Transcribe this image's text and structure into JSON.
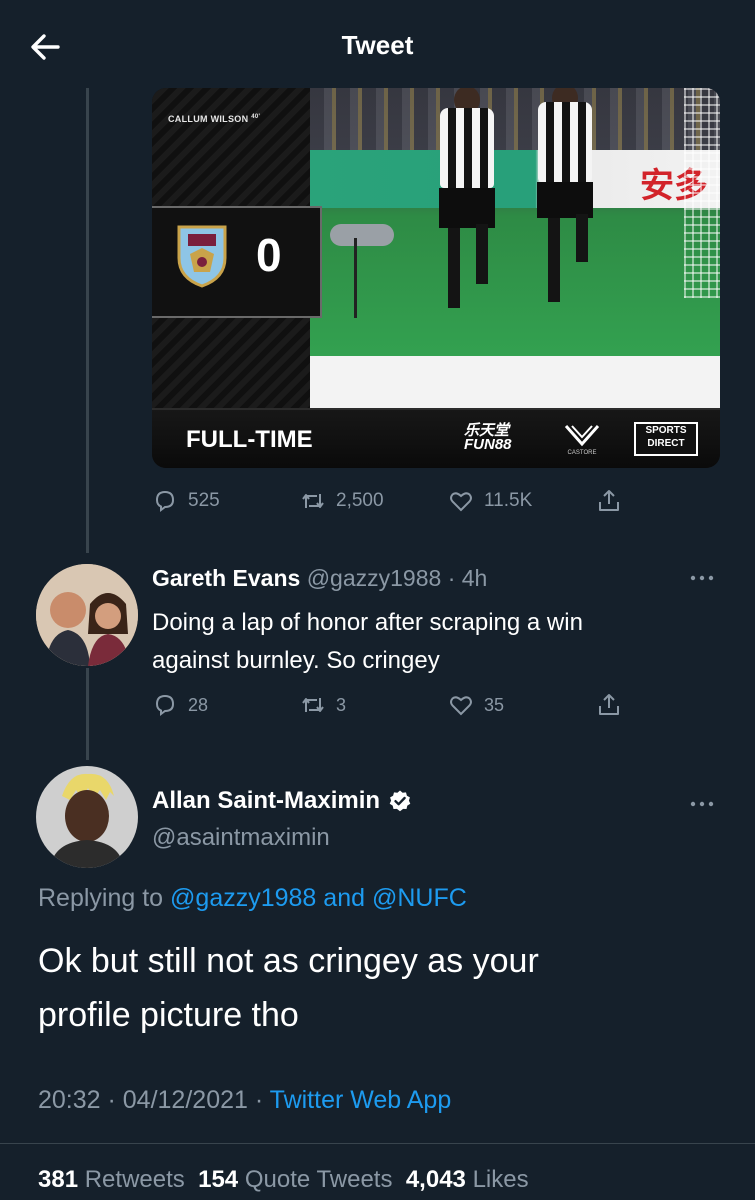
{
  "header": {
    "title": "Tweet"
  },
  "quoted_media": {
    "scorer_text": "CALLUM WILSON",
    "scorer_minute": "40'",
    "score": "0",
    "status": "FULL-TIME",
    "sponsor_1": "乐天堂\nFUN88",
    "sponsor_2": "CASTORE",
    "sponsor_3": "SPORTS\nDIRECT",
    "ad_text": "安多"
  },
  "top_tweet_actions": {
    "replies": "525",
    "retweets": "2,500",
    "likes": "11.5K"
  },
  "reply_tweet": {
    "name": "Gareth Evans",
    "handle": "@gazzy1988",
    "time": "· 4h",
    "text_line1": "Doing a lap of honor after scraping a win",
    "text_line2": "against burnley. So cringey",
    "replies": "28",
    "retweets": "3",
    "likes": "35"
  },
  "main_tweet": {
    "name": "Allan Saint-Maximin",
    "handle": "@asaintmaximin",
    "replying_prefix": "Replying to",
    "replying_to_1": "@gazzy1988",
    "replying_and": "and",
    "replying_to_2": "@NUFC",
    "text_line1": "Ok but still not as cringey as your",
    "text_line2": "profile picture tho",
    "timestamp": "20:32 · 04/12/2021 ·",
    "source": "Twitter Web App"
  },
  "stats": {
    "retweets_count": "381",
    "retweets_label": "Retweets",
    "quotes_count": "154",
    "quotes_label": "Quote Tweets",
    "likes_count": "4,043",
    "likes_label": "Likes"
  },
  "icons": {
    "back": "arrow-left-icon",
    "reply": "reply-icon",
    "retweet": "retweet-icon",
    "like": "heart-icon",
    "share": "share-icon",
    "verified": "verified-badge-icon",
    "more": "more-icon"
  },
  "colors": {
    "background": "#15202b",
    "muted": "#8b98a5",
    "link": "#1d9bf0",
    "divider": "#38444d"
  }
}
